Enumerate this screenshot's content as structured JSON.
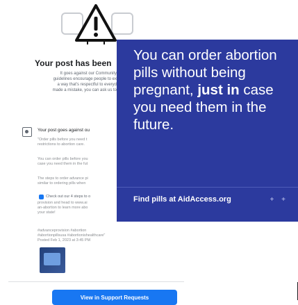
{
  "dialog": {
    "title": "Your post has been",
    "body_lines": [
      "It goes against our Community",
      "guidelines encourage people to ex",
      "a way that's respectful to everyd",
      "made a mistake, you can ask us to"
    ],
    "post_row_text": "Your post goes against ou",
    "post_quote_lines": [
      "\"Order pills before you need t",
      "restrictions to abortion care."
    ],
    "detail_lines_1": [
      "You can order pills before you",
      "case you need them in the fut"
    ],
    "detail_lines_2": [
      "The steps to order advance pi",
      "similar to ordering pills when"
    ],
    "check_text": "Check out our 4 steps to o",
    "check_lines": [
      "provision and head to www.ai",
      "an-abortion to learn more abo",
      "your state!"
    ],
    "hashtag_lines": [
      "#advanceprovision #abortion",
      "#abortionpillsusa #abortionishealthcare\"",
      "Posted Feb 1, 2023 at 3:45 PM"
    ],
    "support_button": "View in Support Requests"
  },
  "ad": {
    "headline_parts": [
      {
        "text": "You can order abortion pills without being pregnant, ",
        "bold": false
      },
      {
        "text": "just in",
        "bold": true
      },
      {
        "text": " case you need them in the future.",
        "bold": false
      }
    ],
    "cta": "Find pills at AidAccess.org",
    "arrows": "+ +"
  },
  "colors": {
    "ad_background": "#2c3a9e",
    "warning": "#111111",
    "button": "#1877f2"
  },
  "icons": [
    "warning-icon",
    "image-placeholder-icon",
    "post-icon",
    "check-icon"
  ]
}
